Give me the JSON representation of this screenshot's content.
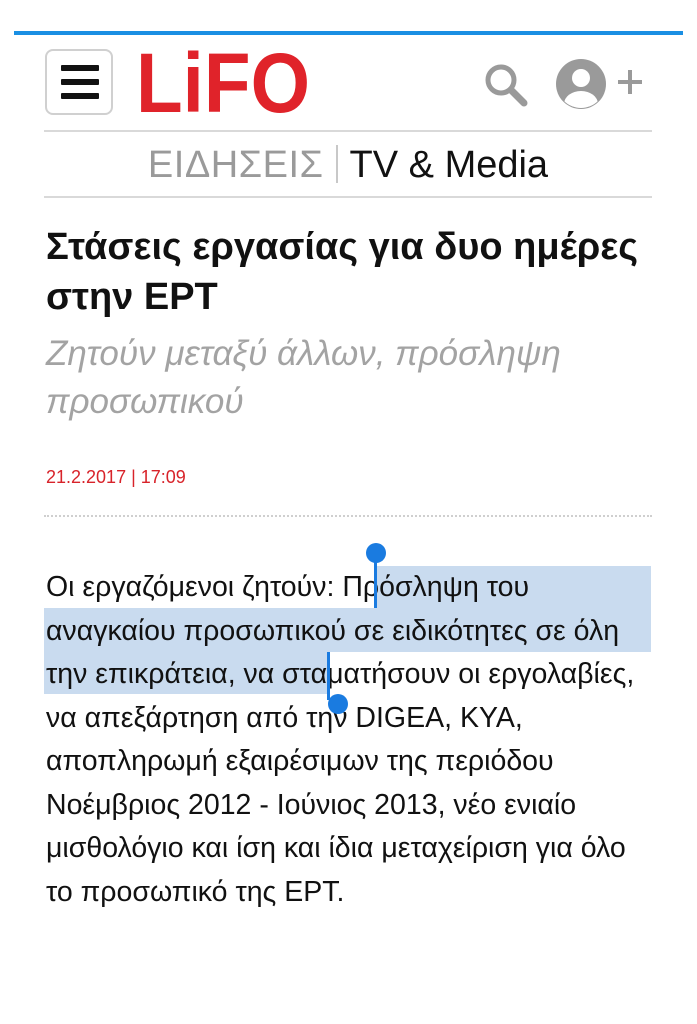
{
  "header": {
    "logo_text": "LiFO"
  },
  "section": {
    "category": "ΕΙΔΗΣΕΙΣ",
    "subcategory": "TV & Media"
  },
  "article": {
    "title": "Στάσεις εργασίας για δυο ημέρες στην ΕΡΤ",
    "subtitle": "Ζητούν μεταξύ άλλων, πρόσληψη προσωπικού",
    "date": "21.2.2017 | 17:09",
    "body": "Οι εργαζόμενοι ζητούν: Πρόσληψη του αναγκαίου προσωπικού σε ειδικότητες σε όλη την επικράτεια, να σταματήσουν οι εργολαβίες, να απεξάρτηση από την DIGEA, ΚΥΑ, αποπληρωμή εξαιρέσιμων της περιόδου Νοέμβριος 2012 - Ιούνιος 2013, νέο ενιαίο μισθολόγιο και ίση και ίδια μεταχείριση για όλο το προσωπικό της ΕΡΤ."
  },
  "icons": {
    "menu": "hamburger-menu-icon",
    "search": "search-icon",
    "account": "account-icon",
    "add": "plus-icon"
  },
  "colors": {
    "accent_bar": "#1a8fe3",
    "logo_red": "#e0232a",
    "date_red": "#d8232a",
    "selection_highlight": "#c9dbef",
    "selection_handle": "#1a7be0",
    "icon_grey": "#9a9a9a"
  }
}
